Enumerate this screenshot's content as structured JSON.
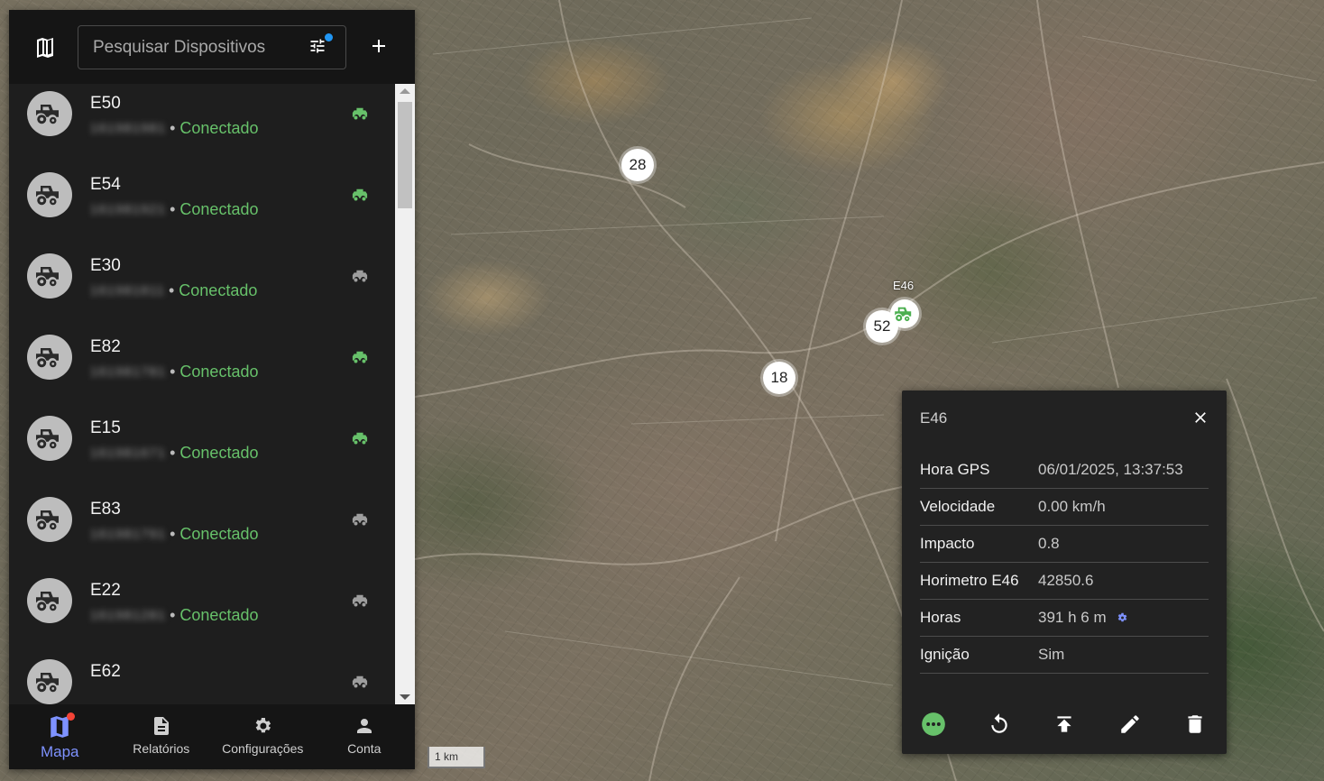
{
  "map": {
    "clusters": [
      "28",
      "52",
      "18"
    ],
    "vehicle_marker_label": "E46",
    "scale_label": "1 km"
  },
  "sidebar": {
    "search": {
      "placeholder": "Pesquisar Dispositivos",
      "value": ""
    },
    "devices": [
      {
        "name": "E50",
        "id": "161981981",
        "status": "Conectado",
        "state": "moving"
      },
      {
        "name": "E54",
        "id": "161981921",
        "status": "Conectado",
        "state": "moving"
      },
      {
        "name": "E30",
        "id": "161981811",
        "status": "Conectado",
        "state": "idle"
      },
      {
        "name": "E82",
        "id": "161981781",
        "status": "Conectado",
        "state": "moving"
      },
      {
        "name": "E15",
        "id": "161981671",
        "status": "Conectado",
        "state": "moving"
      },
      {
        "name": "E83",
        "id": "161981791",
        "status": "Conectado",
        "state": "idle"
      },
      {
        "name": "E22",
        "id": "161981281",
        "status": "Conectado",
        "state": "idle"
      },
      {
        "name": "E62",
        "id": "",
        "status": "",
        "state": "idle"
      }
    ],
    "nav": [
      {
        "label": "Mapa",
        "icon": "map-icon",
        "active": true
      },
      {
        "label": "Relatórios",
        "icon": "description-icon",
        "active": false
      },
      {
        "label": "Configurações",
        "icon": "settings-icon",
        "active": false
      },
      {
        "label": "Conta",
        "icon": "person-icon",
        "active": false
      }
    ]
  },
  "popup": {
    "title": "E46",
    "attributes": [
      {
        "key": "Hora GPS",
        "value": "06/01/2025, 13:37:53"
      },
      {
        "key": "Velocidade",
        "value": "0.00 km/h"
      },
      {
        "key": "Impacto",
        "value": "0.8"
      },
      {
        "key": "Horimetro E46",
        "value": "42850.6"
      },
      {
        "key": "Horas",
        "value": "391 h 6 m"
      },
      {
        "key": "Ignição",
        "value": "Sim"
      }
    ],
    "actions": [
      "more-icon",
      "replay-icon",
      "upload-icon",
      "edit-icon",
      "delete-icon"
    ]
  },
  "colors": {
    "connected": "#67c16a",
    "accent": "#7e92ff",
    "filter_badge": "#2196f3",
    "nav_badge": "#f44336"
  }
}
